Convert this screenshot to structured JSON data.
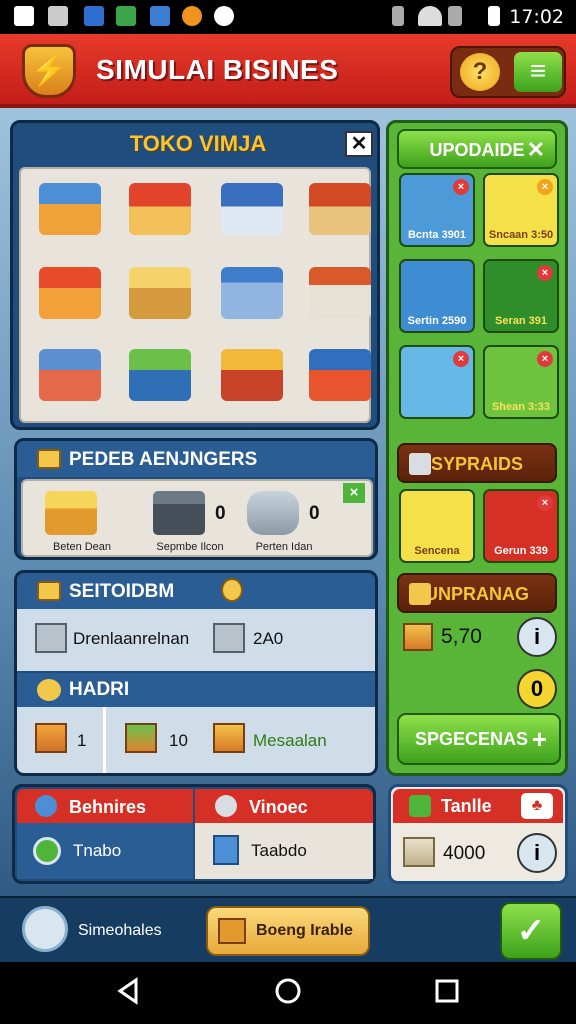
{
  "status_bar": {
    "time": "17:02"
  },
  "header": {
    "title": "SIMULAI BISINES"
  },
  "shop": {
    "title": "TOKO VIMJA"
  },
  "suppliers": {
    "title": "PEDEB AENJNGERS",
    "items": [
      {
        "label": "Beten Dean",
        "count": ""
      },
      {
        "label": "Sepmbe Ilcon",
        "count": "0"
      },
      {
        "label": "Perten Idan",
        "count": "0"
      }
    ]
  },
  "stock": {
    "title": "SEITOIDBM",
    "row1": {
      "label": "Drenlaanrelnan",
      "value": "2A0"
    },
    "title2": "HADRI",
    "row2": [
      {
        "value": "1"
      },
      {
        "value": "10"
      },
      {
        "value": "Mesaalan"
      }
    ]
  },
  "tabs": {
    "left": {
      "title": "Behnires",
      "value": "Tnabo"
    },
    "right": {
      "title": "Vinoec",
      "value": "Taabdo"
    }
  },
  "upgrade": {
    "title": "UPODAIDE",
    "tiles": [
      {
        "label": "Bcnta 3901"
      },
      {
        "label": "Sncaan 3:50"
      },
      {
        "label": "Sertin 2590"
      },
      {
        "label": "Seran 391"
      },
      {
        "label": ""
      },
      {
        "label": "Shean 3:33"
      }
    ]
  },
  "syprads": {
    "title": "SYPRAIDS",
    "tiles": [
      {
        "label": "Sencena"
      },
      {
        "label": "Gerun 339"
      }
    ]
  },
  "unprang": {
    "title": "UNPRANAG",
    "money": "5,70",
    "info_icon": "i",
    "coin_icon": "0",
    "action": "SPGECENAS"
  },
  "tanlle": {
    "title": "Tanlle",
    "value": "4000",
    "info_icon": "i"
  },
  "bottom": {
    "label": "Simeohales",
    "button": "Boeng Irable"
  },
  "colors": {
    "header_red": "#d92a22",
    "panel_blue": "#1f4d7e",
    "accent_green": "#58b537",
    "gold": "#f5c534"
  }
}
